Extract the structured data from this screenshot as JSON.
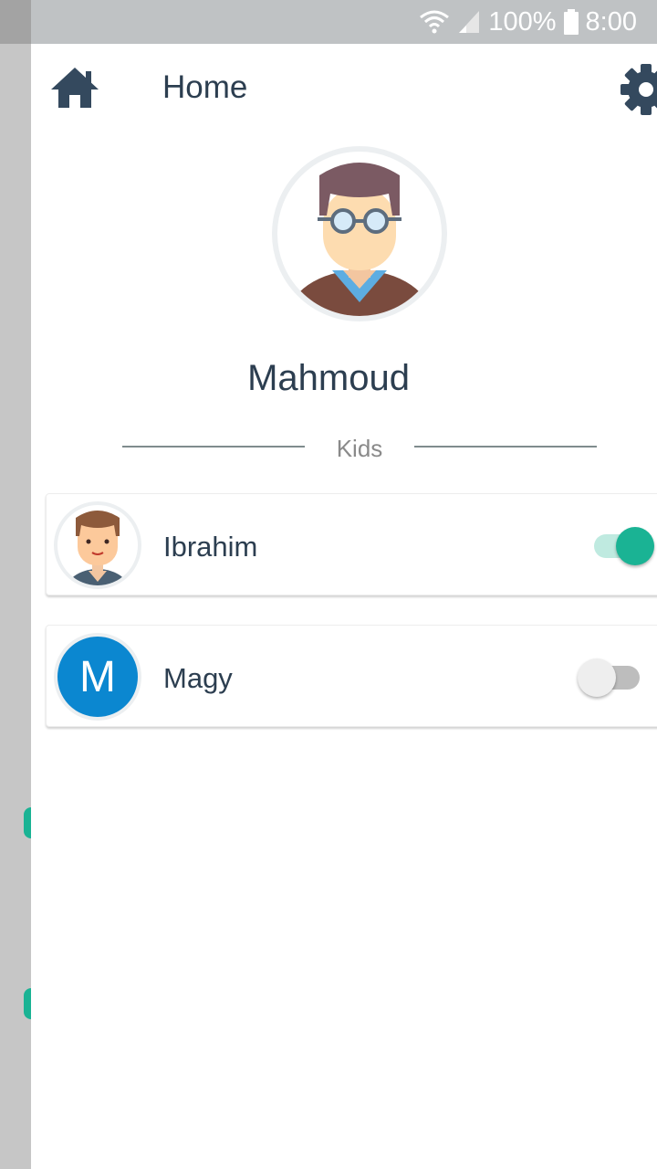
{
  "status_bar": {
    "battery_percent": "100%",
    "time": "8:00",
    "icons": [
      "wifi-icon",
      "signal-icon",
      "battery-icon"
    ]
  },
  "header": {
    "title": "Home",
    "icons": [
      "home-icon",
      "gear-icon"
    ]
  },
  "profile": {
    "name": "Mahmoud",
    "avatar": "man-with-glasses-avatar"
  },
  "kids_section": {
    "label": "Kids",
    "items": [
      {
        "name": "Ibrahim",
        "avatar": "boy-avatar",
        "enabled": true
      },
      {
        "name": "Magy",
        "avatar_letter": "M",
        "enabled": false
      }
    ]
  },
  "colors": {
    "primary_text": "#2c3e50",
    "accent": "#1ab394",
    "letter_avatar": "#0b87d0"
  }
}
